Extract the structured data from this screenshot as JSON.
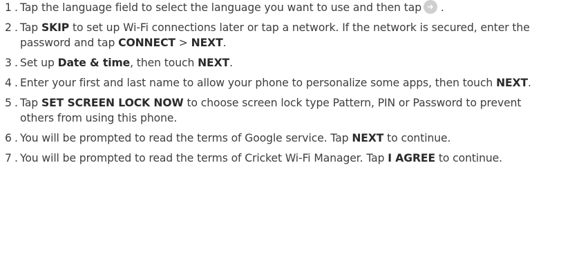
{
  "steps": [
    {
      "num": "1",
      "text_a": "Tap the language field to select the language you want to use and then tap",
      "text_b": "."
    },
    {
      "num": "2",
      "t1": "Tap ",
      "b1": "SKIP",
      "t2": " to set up Wi-Fi connections later or tap a network. If the network is secured, enter the password and tap ",
      "b2": "CONNECT",
      "t3": " > ",
      "b3": "NEXT",
      "t4": "."
    },
    {
      "num": "3",
      "t1": "Set up ",
      "b1": "Date & time",
      "t2": ", then touch ",
      "b2": "NEXT",
      "t3": "."
    },
    {
      "num": "4",
      "t1": "Enter your first and last name to allow your phone to personalize some apps, then touch ",
      "b1": "NEXT",
      "t2": "."
    },
    {
      "num": "5",
      "t1": "Tap ",
      "b1": "SET SCREEN LOCK NOW",
      "t2": " to choose screen lock type Pattern, PIN or Password to prevent others from using this phone."
    },
    {
      "num": "6",
      "t1": "You will be prompted to read the terms of Google service. Tap ",
      "b1": "NEXT",
      "t2": " to continue."
    },
    {
      "num": "7",
      "t1": "You will be prompted to read the terms of Cricket Wi-Fi Manager. Tap ",
      "b1": "I AGREE",
      "t2": " to continue."
    }
  ],
  "icons": {
    "next_button": "arrow-right-circle-icon"
  }
}
